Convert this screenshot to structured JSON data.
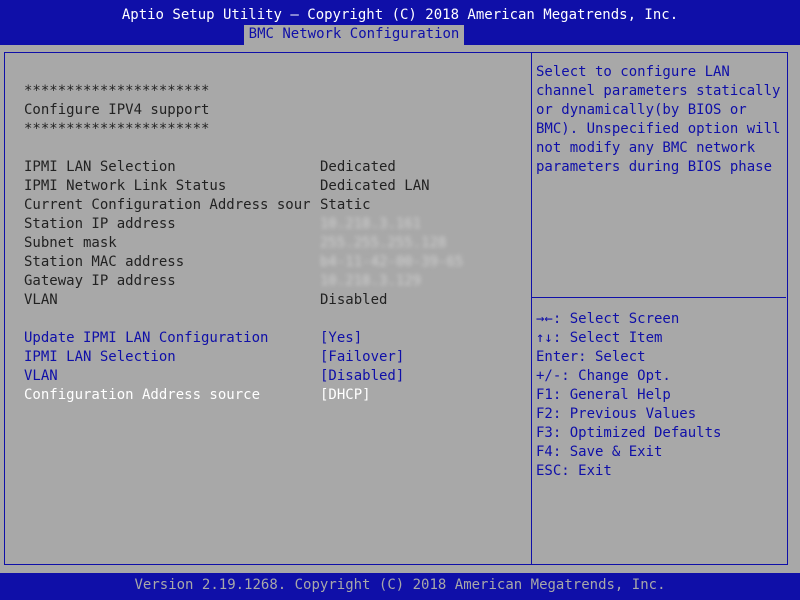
{
  "header": {
    "title": "Aptio Setup Utility – Copyright (C) 2018 American Megatrends, Inc.",
    "tab": "BMC Network Configuration"
  },
  "main": {
    "separator": "**********************",
    "section_title": "Configure IPV4 support",
    "info_rows": [
      {
        "label": "IPMI LAN Selection",
        "value": "Dedicated"
      },
      {
        "label": "IPMI Network Link Status",
        "value": "Dedicated LAN"
      },
      {
        "label": "Current Configuration Address sour",
        "value": "Static"
      },
      {
        "label": "Station IP address",
        "value": "10.218.3.161"
      },
      {
        "label": "Subnet mask",
        "value": "255.255.255.128"
      },
      {
        "label": "Station MAC address",
        "value": "b4-11-42-00-39-65"
      },
      {
        "label": "Gateway IP address",
        "value": "10.218.3.129"
      },
      {
        "label": "VLAN",
        "value": "Disabled"
      }
    ],
    "options": [
      {
        "label": "Update IPMI LAN Configuration",
        "value": "[Yes]"
      },
      {
        "label": "IPMI LAN Selection",
        "value": "[Failover]"
      },
      {
        "label": "VLAN",
        "value": "[Disabled]"
      },
      {
        "label": "Configuration Address source",
        "value": "[DHCP]"
      }
    ]
  },
  "help": {
    "lines": [
      "Select to configure LAN",
      "channel parameters statically",
      "or dynamically(by BIOS or",
      "BMC). Unspecified option will",
      "not modify any BMC network",
      "parameters during BIOS phase"
    ]
  },
  "keys": [
    "→←: Select Screen",
    "↑↓: Select Item",
    "Enter: Select",
    "+/-: Change Opt.",
    "F1: General Help",
    "F2: Previous Values",
    "F3: Optimized Defaults",
    "F4: Save & Exit",
    "ESC: Exit"
  ],
  "footer": {
    "text": "Version 2.19.1268. Copyright (C) 2018 American Megatrends, Inc."
  },
  "colors": {
    "bios_blue": "#0f0fa8",
    "bios_gray": "#a8a8a8",
    "text_dark": "#222222",
    "text_white": "#ffffff"
  }
}
